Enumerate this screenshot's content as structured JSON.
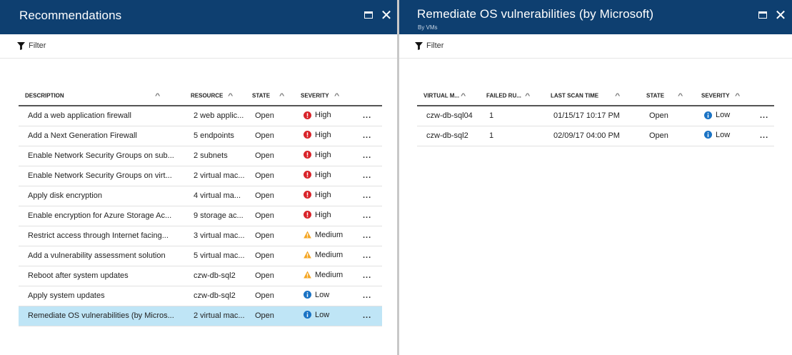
{
  "left_blade": {
    "title": "Recommendations",
    "filter_label": "Filter",
    "columns": [
      "DESCRIPTION",
      "RESOURCE",
      "STATE",
      "SEVERITY"
    ],
    "rows": [
      {
        "description": "Add a web application firewall",
        "resource": "2 web applic...",
        "state": "Open",
        "severity": "High",
        "severity_icon": "error-icon"
      },
      {
        "description": "Add a Next Generation Firewall",
        "resource": "5 endpoints",
        "state": "Open",
        "severity": "High",
        "severity_icon": "error-icon"
      },
      {
        "description": "Enable Network Security Groups on sub...",
        "resource": "2 subnets",
        "state": "Open",
        "severity": "High",
        "severity_icon": "error-icon"
      },
      {
        "description": "Enable Network Security Groups on virt...",
        "resource": "2 virtual mac...",
        "state": "Open",
        "severity": "High",
        "severity_icon": "error-icon"
      },
      {
        "description": "Apply disk encryption",
        "resource": "4 virtual ma...",
        "state": "Open",
        "severity": "High",
        "severity_icon": "error-icon"
      },
      {
        "description": "Enable encryption for Azure Storage Ac...",
        "resource": "9 storage ac...",
        "state": "Open",
        "severity": "High",
        "severity_icon": "error-icon"
      },
      {
        "description": "Restrict access through Internet facing...",
        "resource": "3 virtual mac...",
        "state": "Open",
        "severity": "Medium",
        "severity_icon": "warning-icon"
      },
      {
        "description": "Add a vulnerability assessment solution",
        "resource": "5 virtual mac...",
        "state": "Open",
        "severity": "Medium",
        "severity_icon": "warning-icon"
      },
      {
        "description": "Reboot after system updates",
        "resource": "czw-db-sql2",
        "state": "Open",
        "severity": "Medium",
        "severity_icon": "warning-icon"
      },
      {
        "description": "Apply system updates",
        "resource": "czw-db-sql2",
        "state": "Open",
        "severity": "Low",
        "severity_icon": "info-icon"
      },
      {
        "description": "Remediate OS vulnerabilities (by Micros...",
        "resource": "2 virtual mac...",
        "state": "Open",
        "severity": "Low",
        "severity_icon": "info-icon",
        "selected": true
      }
    ]
  },
  "right_blade": {
    "title": "Remediate OS vulnerabilities (by Microsoft)",
    "subtitle": "By VMs",
    "filter_label": "Filter",
    "columns": [
      "VIRTUAL M...",
      "FAILED RU...",
      "LAST SCAN TIME",
      "STATE",
      "SEVERITY"
    ],
    "rows": [
      {
        "vm": "czw-db-sql04",
        "failed_rules": "1",
        "last_scan": "01/15/17 10:17 PM",
        "state": "Open",
        "severity": "Low",
        "severity_icon": "info-icon"
      },
      {
        "vm": "czw-db-sql2",
        "failed_rules": "1",
        "last_scan": "02/09/17 04:00 PM",
        "state": "Open",
        "severity": "Low",
        "severity_icon": "info-icon"
      }
    ]
  },
  "more_label": "...",
  "colors": {
    "header_bg": "#0e3f70",
    "selected_row": "#bfe5f6",
    "high": "#d9242a",
    "medium": "#f5a623",
    "low": "#1a73c4"
  }
}
